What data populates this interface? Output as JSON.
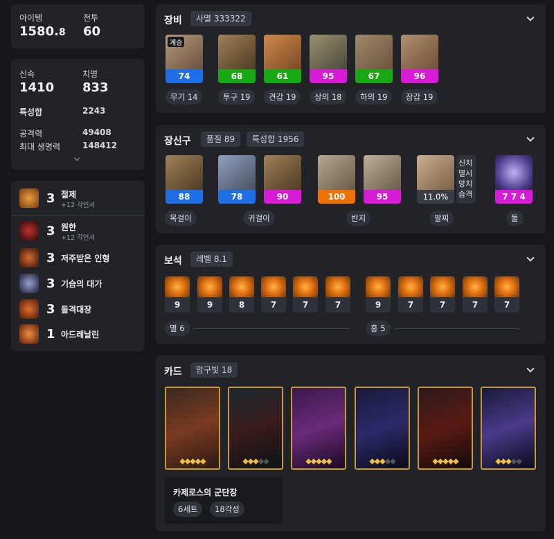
{
  "summary": {
    "item_level_label": "아이템",
    "item_level": "1580.",
    "item_level_decimal": "8",
    "combat_label": "전투",
    "combat_level": "60"
  },
  "stats": {
    "swiftness_label": "신속",
    "swiftness": "1410",
    "crit_label": "치명",
    "crit": "833",
    "total_label": "특성합",
    "total": "2243",
    "atk_label": "공격력",
    "atk": "49408",
    "hp_label": "최대 생명력",
    "hp": "148412"
  },
  "engravings": [
    {
      "level": "3",
      "name": "절제",
      "sub": "+12 각인서",
      "icon": "engraving-restraint-icon",
      "color": "#b5652a"
    },
    {
      "level": "3",
      "name": "원한",
      "sub": "+12 각인서",
      "icon": "engraving-grudge-icon",
      "color": "#7a2424"
    },
    {
      "level": "3",
      "name": "저주받은 인형",
      "sub": "",
      "icon": "engraving-cursed-doll-icon",
      "color": "#8a3a20"
    },
    {
      "level": "3",
      "name": "기습의 대가",
      "sub": "",
      "icon": "engraving-ambush-master-icon",
      "color": "#3a4066"
    },
    {
      "level": "3",
      "name": "돌격대장",
      "sub": "",
      "icon": "engraving-raid-captain-icon",
      "color": "#a0401a"
    },
    {
      "level": "1",
      "name": "아드레날린",
      "sub": "",
      "icon": "engraving-adrenaline-icon",
      "color": "#c05020"
    }
  ],
  "equipment": {
    "title": "장비",
    "badge": "사멸 333322",
    "items": [
      {
        "quality": "74",
        "quality_color": "blue",
        "label": "무기 14",
        "tag": "계승",
        "icon": "weapon-icon"
      },
      {
        "quality": "68",
        "quality_color": "green",
        "label": "투구 19",
        "tag": "",
        "icon": "helmet-icon"
      },
      {
        "quality": "61",
        "quality_color": "green",
        "label": "견갑 19",
        "tag": "",
        "icon": "shoulder-icon"
      },
      {
        "quality": "95",
        "quality_color": "magenta",
        "label": "상의 18",
        "tag": "",
        "icon": "chest-icon"
      },
      {
        "quality": "67",
        "quality_color": "green",
        "label": "하의 19",
        "tag": "",
        "icon": "pants-icon"
      },
      {
        "quality": "96",
        "quality_color": "magenta",
        "label": "장갑 19",
        "tag": "",
        "icon": "gloves-icon"
      }
    ]
  },
  "accessories": {
    "title": "장신구",
    "quality_badge": "품질 89",
    "total_badge": "특성합 1956",
    "items": [
      {
        "quality": "88",
        "quality_color": "blue",
        "icon": "necklace-icon"
      },
      {
        "quality": "78",
        "quality_color": "blue",
        "icon": "earring-icon"
      },
      {
        "quality": "90",
        "quality_color": "magenta",
        "icon": "earring-icon"
      },
      {
        "quality": "100",
        "quality_color": "orange",
        "icon": "ring-icon"
      },
      {
        "quality": "95",
        "quality_color": "magenta",
        "icon": "ring-icon"
      },
      {
        "quality": "11.0%",
        "quality_color": "gray",
        "icon": "bracelet-icon"
      },
      {
        "quality": "7 7 4",
        "quality_color": "magenta",
        "icon": "ability-stone-icon"
      }
    ],
    "labels": {
      "necklace": "목걸이",
      "earring": "귀걸이",
      "ring": "반지",
      "bracelet": "팔찌",
      "stone": "돌"
    },
    "bracelet_effects": [
      "신치",
      "멸시",
      "망치",
      "습격"
    ]
  },
  "gems": {
    "title": "보석",
    "badge": "레벨 8.1",
    "damage": [
      "9",
      "9",
      "8",
      "7",
      "7",
      "7"
    ],
    "cooldown": [
      "9",
      "7",
      "7",
      "7",
      "7"
    ],
    "damage_label": "멸 6",
    "cooldown_label": "홍 5"
  },
  "cards": {
    "title": "카드",
    "badge": "암구빛 18",
    "set_name": "카제로스의 군단장",
    "set_count": "6세트",
    "awakening": "18각성",
    "list": [
      {
        "icon": "card-1-icon",
        "awakened": 5
      },
      {
        "icon": "card-2-icon",
        "awakened": 3
      },
      {
        "icon": "card-3-icon",
        "awakened": 5
      },
      {
        "icon": "card-4-icon",
        "awakened": 3
      },
      {
        "icon": "card-5-icon",
        "awakened": 5
      },
      {
        "icon": "card-6-icon",
        "awakened": 3
      }
    ]
  }
}
